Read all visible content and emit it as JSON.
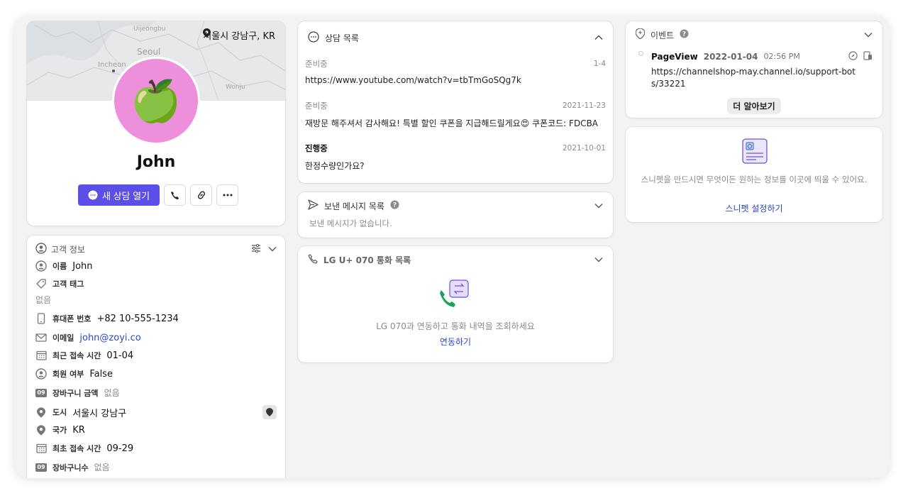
{
  "profile": {
    "location": "서울시 강남구, KR",
    "map_labels": [
      "Uijeongbu",
      "Seoul",
      "Incheon",
      "Wonju"
    ],
    "avatar_emoji": "🍏",
    "name": "John",
    "new_consult_label": "새 상담 열기",
    "accent_color": "#5b4fe8"
  },
  "customer_info": {
    "title": "고객 정보",
    "rows": [
      {
        "icon": "user-icon",
        "label": "이름",
        "value": "John"
      },
      {
        "icon": "tag-icon",
        "label": "고객 태그",
        "value": "없음"
      },
      {
        "icon": "phone-icon",
        "label": "휴대폰 번호",
        "value": "+82 10-555-1234"
      },
      {
        "icon": "mail-icon",
        "label": "이메일",
        "value": "john@zoyi.co"
      },
      {
        "icon": "calendar-icon",
        "label": "최근 접속 시간",
        "value": "01-04"
      },
      {
        "icon": "user-icon",
        "label": "회원 여부",
        "value": "False"
      },
      {
        "icon": "number-icon",
        "label": "장바구니 금액",
        "value": "없음"
      },
      {
        "icon": "pin-icon",
        "label": "도시",
        "value": "서울시 강남구"
      },
      {
        "icon": "pin-icon",
        "label": "국가",
        "value": "KR"
      },
      {
        "icon": "calendar-icon",
        "label": "최초 접속 시간",
        "value": "09-29"
      },
      {
        "icon": "number-icon",
        "label": "장바구니수",
        "value": "없음"
      }
    ],
    "number_icon_text": "09"
  },
  "consult_list": {
    "title": "상담 목록",
    "items": [
      {
        "status": "준비중",
        "date": "1-4",
        "message": "https://www.youtube.com/watch?v=tbTmGoSQg7k"
      },
      {
        "status": "준비중",
        "date": "2021-11-23",
        "message": "재방문 해주셔서 감사해요! 특별 할인 쿠폰을 지급해드릴게요😍 쿠폰코드: FDCBA"
      },
      {
        "status": "진행중",
        "date": "2021-10-01",
        "message": "한정수량인가요?"
      }
    ]
  },
  "sent_messages": {
    "title": "보낸 메시지 목록",
    "empty": "보낸 메시지가 없습니다."
  },
  "lg_call": {
    "title": "LG U+ 070 통화 목록",
    "description": "LG 070과 연동하고 통화 내역을 조회하세요",
    "link": "연동하기"
  },
  "events": {
    "title": "이벤트",
    "event_name": "PageView",
    "event_date": "2022-01-04",
    "event_time": "02:56 PM",
    "url": "https://channelshop-may.channel.io/support-bots/33221",
    "more_label": "더 알아보기"
  },
  "snippet": {
    "description": "스니펫을 만드시면 무엇이든 원하는 정보를 이곳에 띄울 수 있어요.",
    "link": "스니펫 설정하기"
  }
}
